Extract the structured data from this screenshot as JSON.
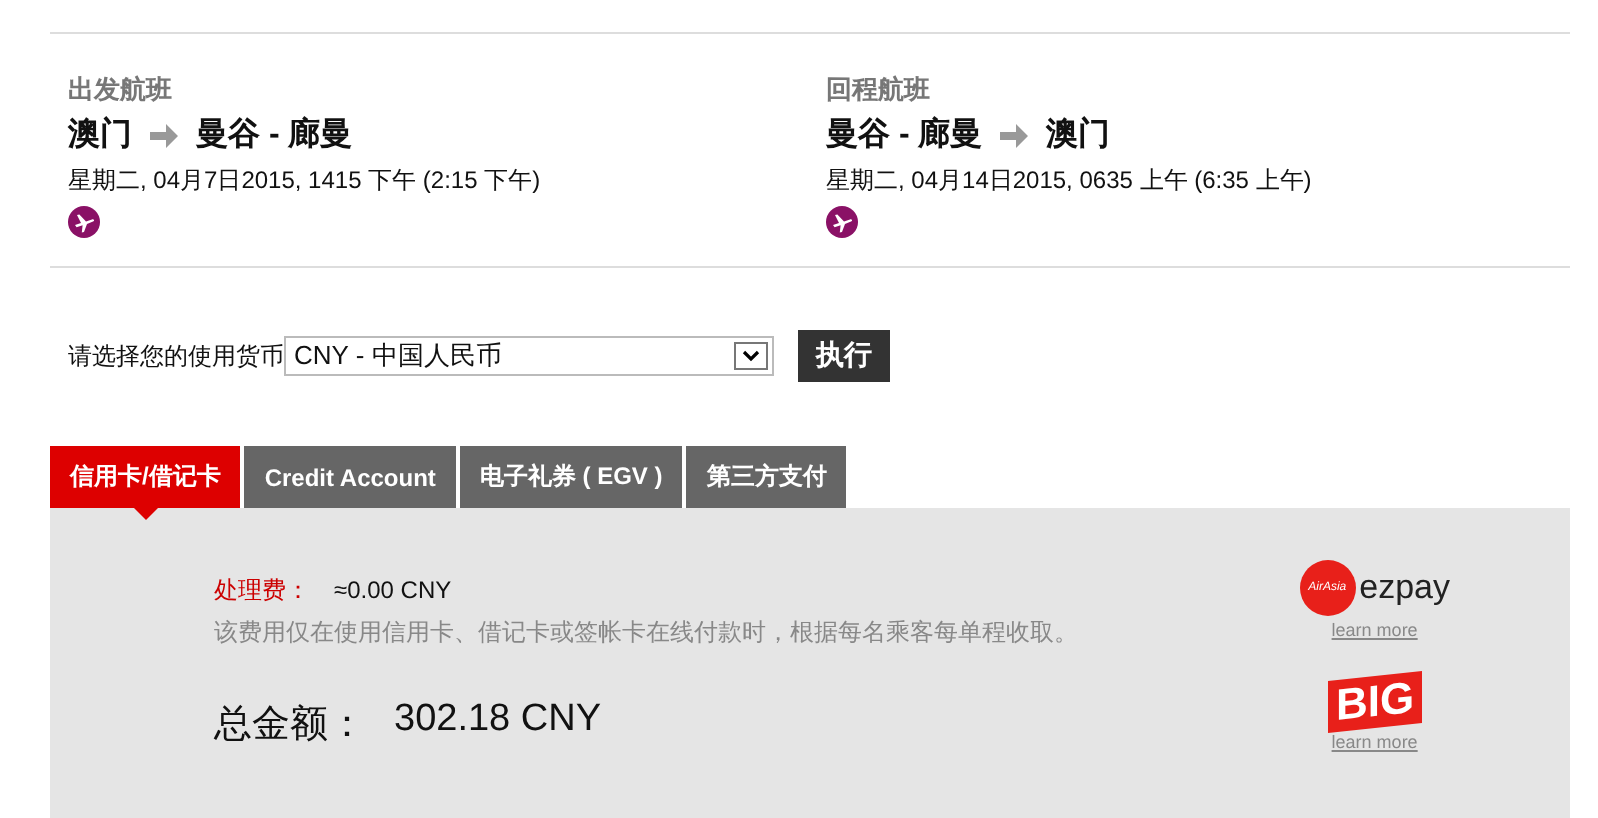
{
  "flights": [
    {
      "heading": "出发航班",
      "from": "澳门",
      "to": "曼谷 - 廊曼",
      "datetime": "星期二, 04月7日2015, 1415 下午 (2:15 下午)"
    },
    {
      "heading": "回程航班",
      "from": "曼谷 - 廊曼",
      "to": "澳门",
      "datetime": "星期二, 04月14日2015, 0635 上午 (6:35 上午)"
    }
  ],
  "currency": {
    "label": "请选择您的使用货币",
    "value": "CNY - 中国人民币",
    "button": "执行"
  },
  "tabs": [
    {
      "label": "信用卡/借记卡",
      "selected": true
    },
    {
      "label": "Credit Account",
      "selected": false
    },
    {
      "label": "电子礼券 ( EGV )",
      "selected": false
    },
    {
      "label": "第三方支付",
      "selected": false
    }
  ],
  "fee": {
    "label": "处理费：",
    "value": "≈0.00 CNY",
    "note": "该费用仅在使用信用卡、借记卡或签帐卡在线付款时，根据每名乘客每单程收取。"
  },
  "total": {
    "label": "总金额：",
    "value": "302.18 CNY"
  },
  "partners": [
    {
      "kind": "ezpay",
      "badge": "AirAsia",
      "name": "ezpay",
      "link": "learn more"
    },
    {
      "kind": "big",
      "name": "BIG",
      "link": "learn more"
    }
  ]
}
